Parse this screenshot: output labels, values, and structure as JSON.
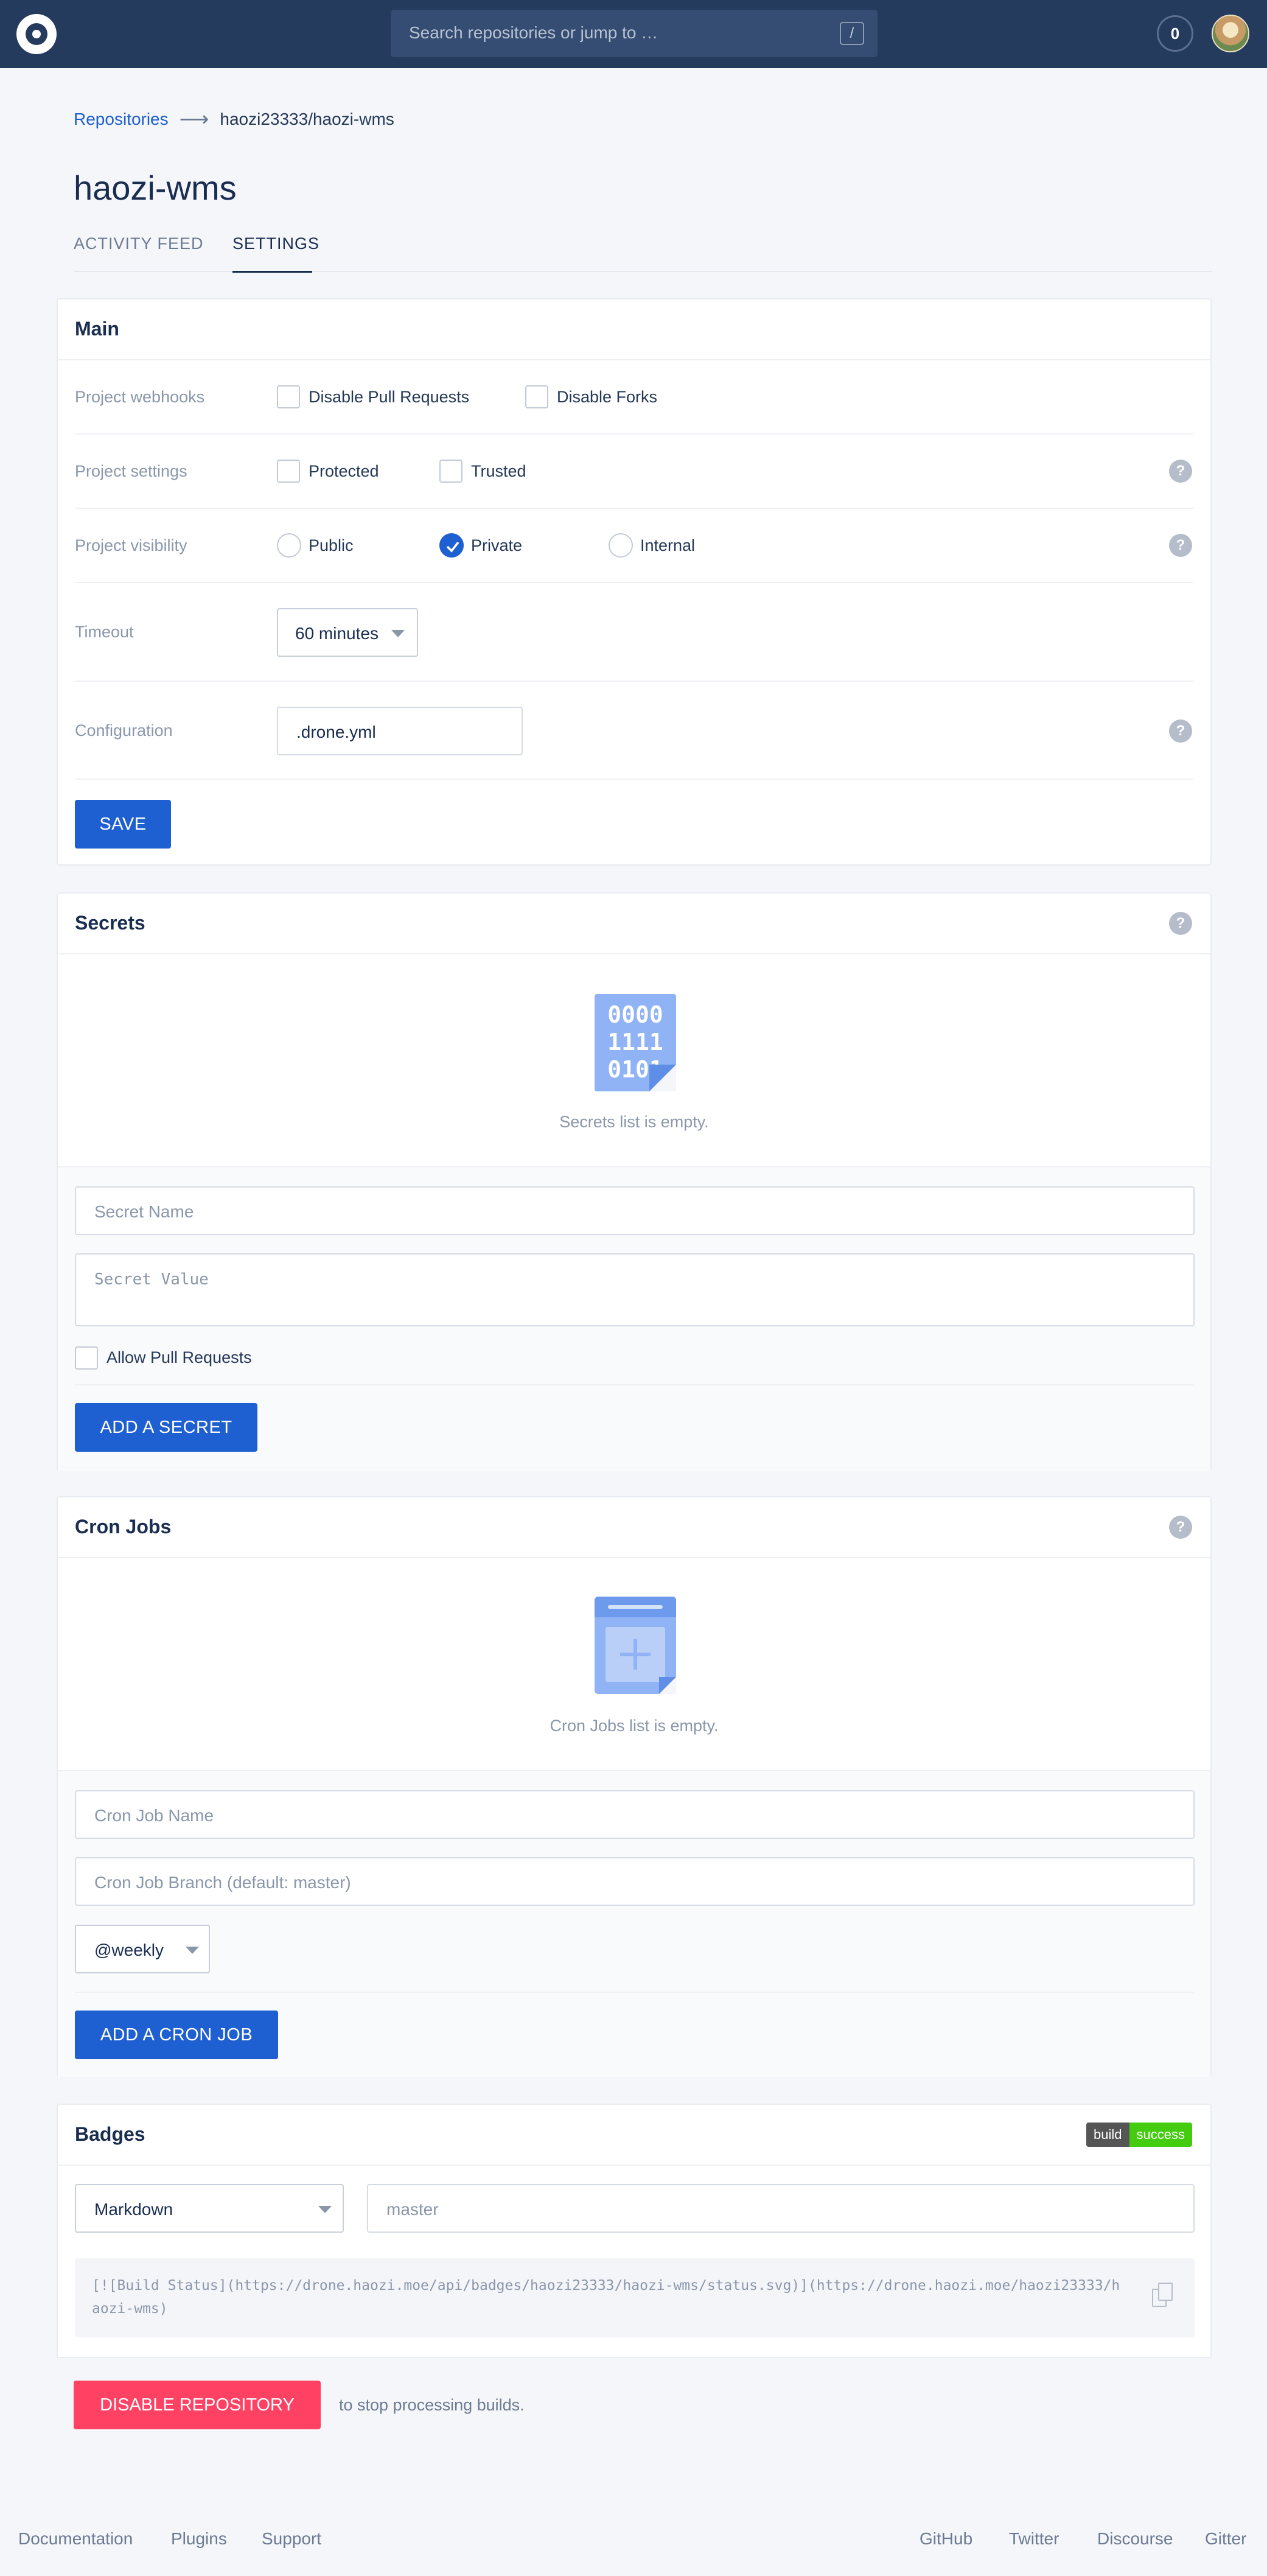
{
  "nav": {
    "search_placeholder": "Search repositories or jump to …",
    "search_shortcut": "/",
    "notification_count": "0"
  },
  "breadcrumb": {
    "root": "Repositories",
    "current": "haozi23333/haozi-wms"
  },
  "repo": {
    "title": "haozi-wms",
    "tabs": [
      {
        "label": "ACTIVITY FEED",
        "active": false
      },
      {
        "label": "SETTINGS",
        "active": true
      }
    ]
  },
  "main": {
    "title": "Main",
    "webhooks": {
      "label": "Project webhooks",
      "options": [
        {
          "label": "Disable Pull Requests",
          "checked": false
        },
        {
          "label": "Disable Forks",
          "checked": false
        }
      ]
    },
    "settings": {
      "label": "Project settings",
      "options": [
        {
          "label": "Protected",
          "checked": false
        },
        {
          "label": "Trusted",
          "checked": false
        }
      ]
    },
    "visibility": {
      "label": "Project visibility",
      "options": [
        {
          "label": "Public",
          "checked": false
        },
        {
          "label": "Private",
          "checked": true
        },
        {
          "label": "Internal",
          "checked": false
        }
      ]
    },
    "timeout": {
      "label": "Timeout",
      "value": "60 minutes"
    },
    "configuration": {
      "label": "Configuration",
      "value": ".drone.yml"
    },
    "save_label": "SAVE",
    "help_symbol": "?"
  },
  "secrets": {
    "title": "Secrets",
    "icon_bits": [
      "0000",
      "1111",
      "0101"
    ],
    "empty_text": "Secrets list is empty.",
    "name_placeholder": "Secret Name",
    "value_placeholder": "Secret Value",
    "allow_pr_label": "Allow Pull Requests",
    "allow_pr_checked": false,
    "add_label": "ADD A SECRET"
  },
  "cron": {
    "title": "Cron Jobs",
    "empty_text": "Cron Jobs list is empty.",
    "name_placeholder": "Cron Job Name",
    "branch_placeholder": "Cron Job Branch (default: master)",
    "schedule_value": "@weekly",
    "add_label": "ADD A CRON JOB"
  },
  "badges": {
    "title": "Badges",
    "badge_left": "build",
    "badge_right": "success",
    "format_value": "Markdown",
    "branch_placeholder": "master",
    "code": "[![Build Status](https://drone.haozi.moe/api/badges/haozi23333/haozi-wms/status.svg)](https://drone.haozi.moe/haozi23333/haozi-wms)"
  },
  "danger": {
    "disable_label": "DISABLE REPOSITORY",
    "note": "to stop processing builds."
  },
  "footer": {
    "left": [
      "Documentation",
      "Plugins",
      "Support"
    ],
    "right": [
      "GitHub",
      "Twitter",
      "Discourse",
      "Gitter"
    ]
  },
  "colors": {
    "nav_bg": "#243b5e",
    "accent": "#1e5fd1",
    "danger": "#ff4164",
    "badge_success": "#44cc11"
  },
  "icons": {
    "logo": "drone-logo-icon",
    "help": "help-icon",
    "secret_empty": "binary-file-icon",
    "cron_empty": "calendar-add-icon",
    "copy": "copy-icon",
    "check": "check-icon",
    "arrow": "arrow-right-icon"
  }
}
